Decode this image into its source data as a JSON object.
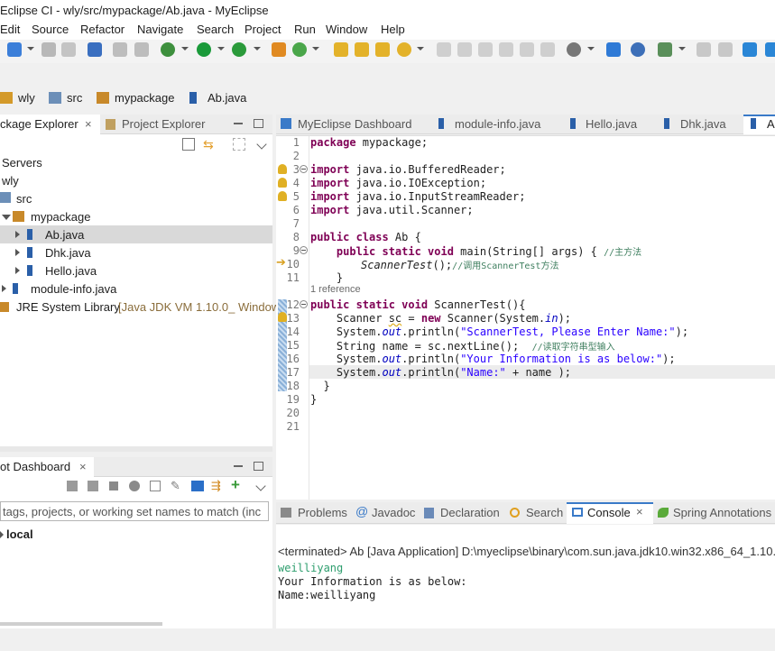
{
  "window": {
    "title": "Eclipse CI - wly/src/mypackage/Ab.java - MyEclipse"
  },
  "menu": [
    "Edit",
    "Source",
    "Refactor",
    "Navigate",
    "Search",
    "Project",
    "Run",
    "Window",
    "Help"
  ],
  "breadcrumb": [
    "wly",
    "src",
    "mypackage",
    "Ab.java"
  ],
  "left_tabs": {
    "package_explorer": "ckage Explorer",
    "project_explorer": "Project Explorer"
  },
  "tree": {
    "servers": "Servers",
    "wly": "wly",
    "src": "src",
    "mypackage": "mypackage",
    "ab": "Ab.java",
    "dhk": "Dhk.java",
    "hello": "Hello.java",
    "module_info": "module-info.java",
    "jre": "JRE System Library",
    "jre_detail": "[Java JDK VM 1.10.0_ Window"
  },
  "editor_tabs": [
    "MyEclipse Dashboard",
    "module-info.java",
    "Hello.java",
    "Dhk.java",
    "A"
  ],
  "code": {
    "l1_kw": "package",
    "l1": " mypackage;",
    "l3_kw": "import",
    "l3": " java.io.BufferedReader;",
    "l4_kw": "import",
    "l4": " java.io.IOException;",
    "l5_kw": "import",
    "l5": " java.io.InputStreamReader;",
    "l6_kw": "import",
    "l6": " java.util.Scanner;",
    "l8_kw": "public class",
    "l8": " Ab {",
    "l9_kw": "    public static void",
    "l9": " main(String[] args) { ",
    "l9_cmt": "//主方法",
    "l10_call": "ScannerTest",
    "l10": "();",
    "l10_cmt": "//调用ScannerTest方法",
    "l11": "    }",
    "reference": "1 reference",
    "l12_kw": "public static void",
    "l12": " ScannerTest(){",
    "l13a": "    Scanner ",
    "l13_var": "sc",
    "l13b": " = ",
    "l13_kw": "new",
    "l13c": " Scanner(System.",
    "l13_fld": "in",
    "l13d": ");",
    "l14a": "    System.",
    "l14_fld": "out",
    "l14b": ".println(",
    "l14_str": "\"ScannerTest, Please Enter Name:\"",
    "l14c": ");",
    "l15a": "    String name = sc.nextLine();  ",
    "l15_cmt": "//读取字符串型输入",
    "l16a": "    System.",
    "l16_fld": "out",
    "l16b": ".println(",
    "l16_str": "\"Your Information is as below:\"",
    "l16c": ");",
    "l17a": "    System.",
    "l17_fld": "out",
    "l17b": ".println(",
    "l17_str": "\"Name:\"",
    "l17c": " + name );",
    "l18": "  }",
    "l19": "}"
  },
  "line_numbers": [
    "1",
    "2",
    "3",
    "4",
    "5",
    "6",
    "7",
    "8",
    "9",
    "10",
    "11",
    "12",
    "13",
    "14",
    "15",
    "16",
    "17",
    "18",
    "19",
    "20",
    "21"
  ],
  "dashboard": {
    "tab": "ot Dashboard",
    "filter_placeholder": "tags, projects, or working set names to match (inc",
    "local": "local"
  },
  "bottom_tabs": [
    "Problems",
    "Javadoc",
    "Declaration",
    "Search",
    "Console",
    "Spring Annotations"
  ],
  "console": {
    "header": "<terminated> Ab [Java Application] D:\\myeclipse\\binary\\com.sun.java.jdk10.win32.x86_64_1.10.",
    "input": "weilliyang",
    "out1": "Your Information is as below:",
    "out2": "Name:weilliyang"
  }
}
